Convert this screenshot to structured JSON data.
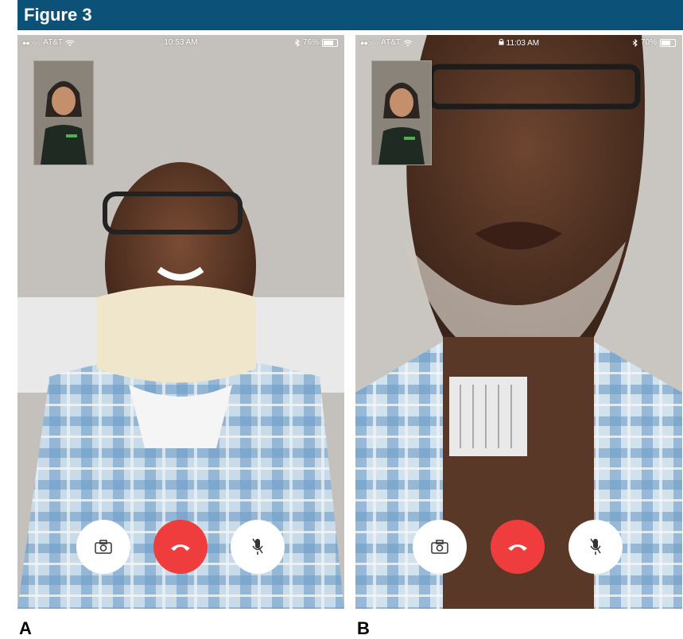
{
  "figure": {
    "title": "Figure 3"
  },
  "panels": [
    {
      "label": "A",
      "status_bar": {
        "carrier": "AT&T",
        "time": "10:53 AM",
        "battery": "76%"
      },
      "battery_level": 0.76
    },
    {
      "label": "B",
      "status_bar": {
        "carrier": "AT&T",
        "time": "11:03 AM",
        "battery": "70%"
      },
      "battery_level": 0.7
    }
  ],
  "colors": {
    "header": "#0c5177",
    "end_call": "#ef3d3d",
    "shirt_blue": "#8fb6d6",
    "skin": "#5a3a2a",
    "collar": "#efe6cc",
    "wall": "#bdbab5"
  },
  "icons": {
    "camera_flip": "camera-flip-icon",
    "end_call": "phone-hangup-icon",
    "mute": "microphone-mute-icon",
    "wifi": "wifi-icon",
    "bluetooth": "bluetooth-icon",
    "lock": "lock-icon"
  }
}
